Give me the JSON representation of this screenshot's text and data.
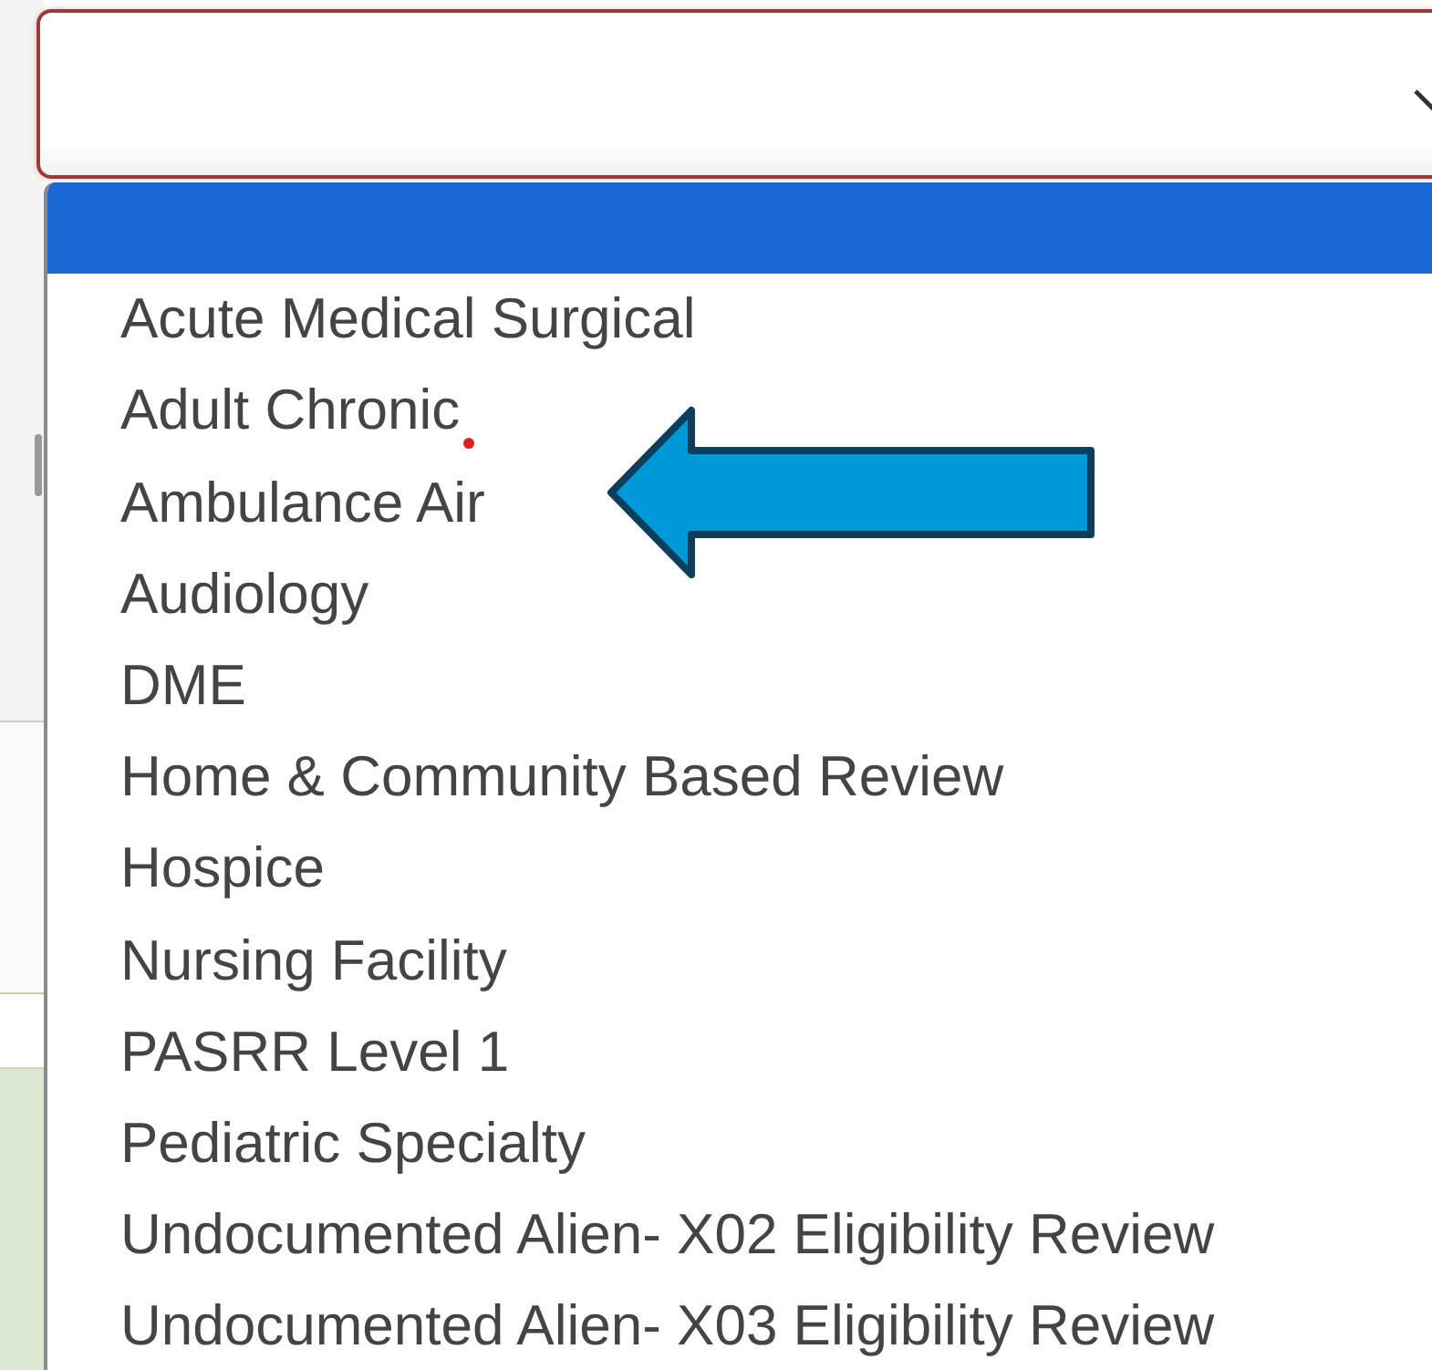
{
  "select": {
    "options": [
      {
        "selected": true
      },
      {
        "label": "Acute Medical Surgical",
        "selected": false
      },
      {
        "label": "Adult Chronic",
        "selected": false
      },
      {
        "label": "Ambulance Air",
        "selected": false
      },
      {
        "label": "Audiology",
        "selected": false
      },
      {
        "label": "DME",
        "selected": false
      },
      {
        "label": "Home & Community Based Review",
        "selected": false
      },
      {
        "label": "Hospice",
        "selected": false
      },
      {
        "label": "Nursing Facility",
        "selected": false
      },
      {
        "label": "PASRR Level 1",
        "selected": false
      },
      {
        "label": "Pediatric Specialty",
        "selected": false
      },
      {
        "label": "Undocumented Alien- X02 Eligibility Review",
        "selected": false
      },
      {
        "label": "Undocumented Alien- X03 Eligibility Review",
        "selected": false
      }
    ]
  }
}
